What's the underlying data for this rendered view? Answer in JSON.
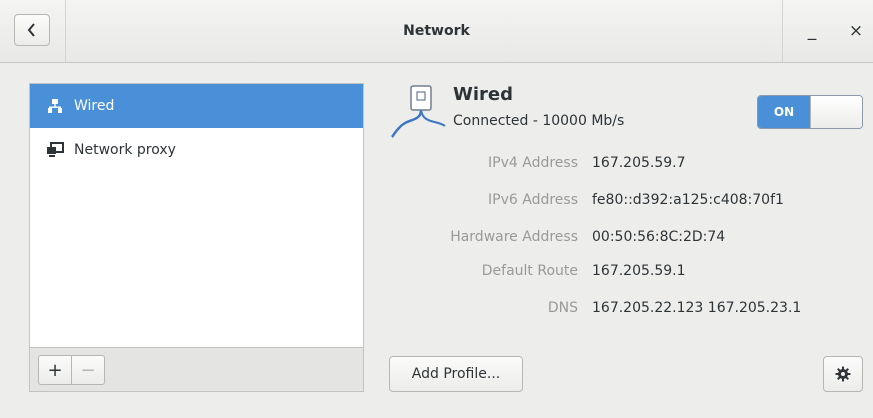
{
  "window": {
    "title": "Network",
    "minimize_glyph": "_",
    "close_glyph": "×"
  },
  "sidebar": {
    "items": [
      {
        "label": "Wired",
        "icon": "wired-network-icon",
        "selected": true
      },
      {
        "label": "Network proxy",
        "icon": "network-proxy-icon",
        "selected": false
      }
    ],
    "add_glyph": "+",
    "remove_glyph": "−"
  },
  "connection": {
    "title": "Wired",
    "status": "Connected - 10000 Mb/s",
    "switch_label": "ON",
    "switch_on": true
  },
  "properties": [
    {
      "label": "IPv4 Address",
      "value": "167.205.59.7"
    },
    {
      "label": "IPv6 Address",
      "value": "fe80::d392:a125:c408:70f1"
    },
    {
      "label": "Hardware Address",
      "value": "00:50:56:8C:2D:74"
    },
    {
      "label": "Default Route",
      "value": "167.205.59.1"
    },
    {
      "label": "DNS",
      "value": "167.205.22.123 167.205.23.1"
    }
  ],
  "footer": {
    "add_profile_label": "Add Profile..."
  },
  "colors": {
    "accent": "#4a90d9",
    "dim_label": "#999a98"
  }
}
